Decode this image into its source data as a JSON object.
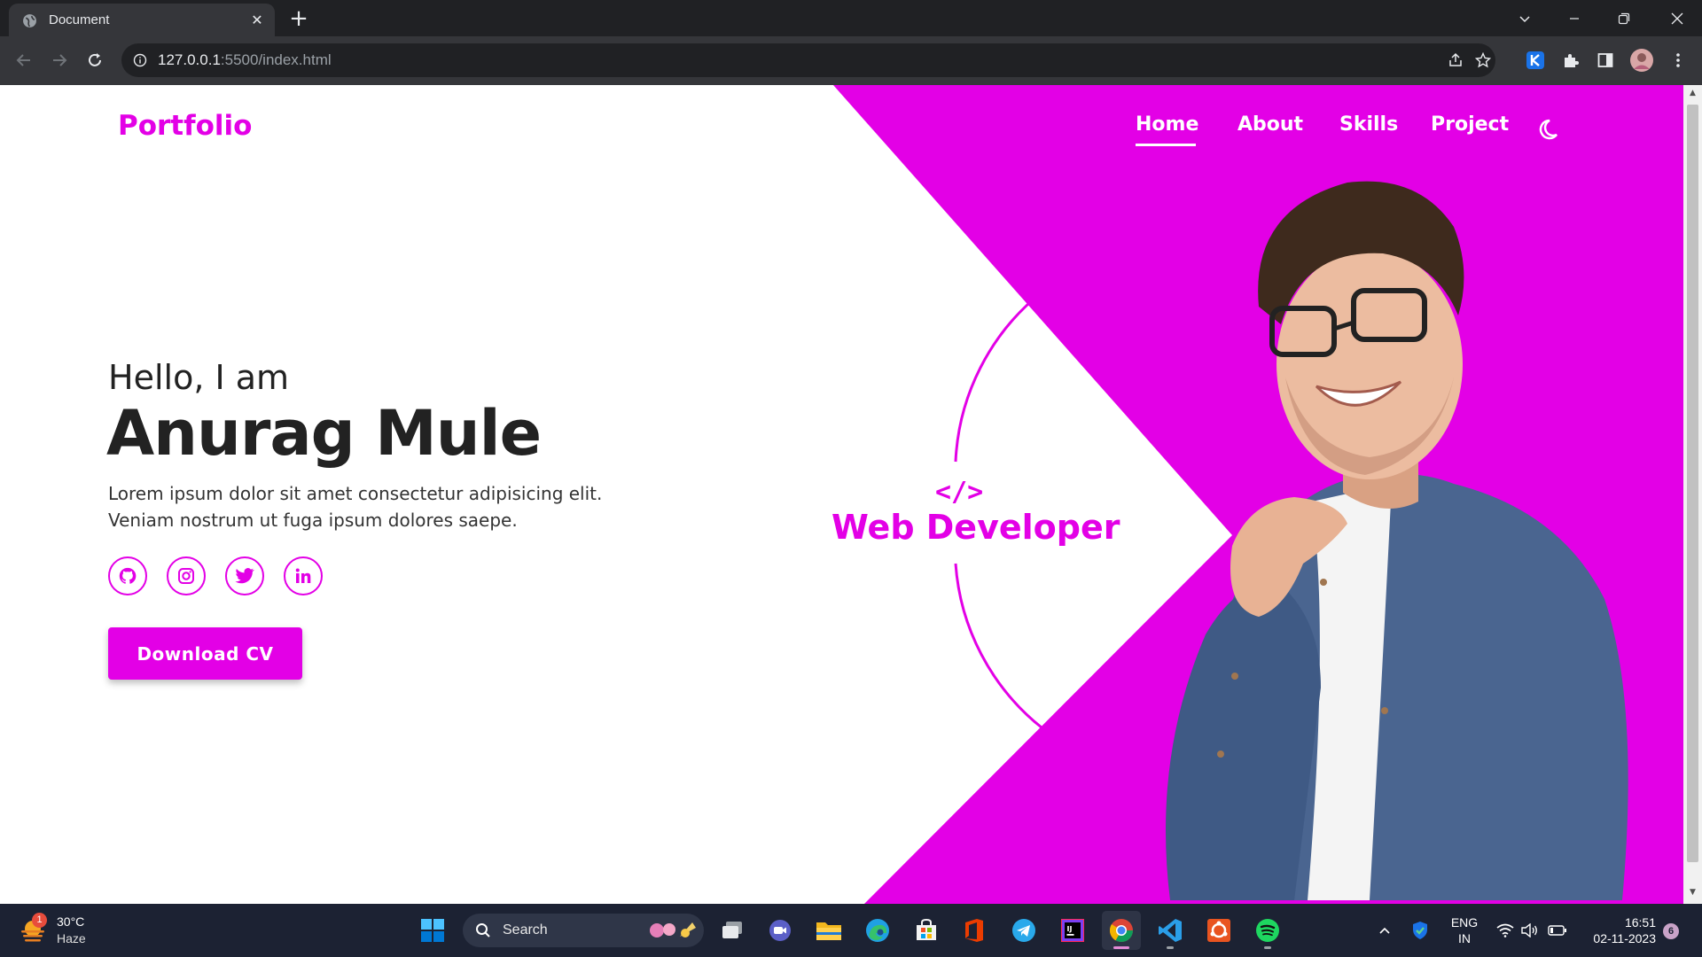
{
  "browser": {
    "tab_title": "Document",
    "url_host": "127.0.0.1",
    "url_rest": ":5500/index.html"
  },
  "site": {
    "logo": "Portfolio",
    "nav": [
      "Home",
      "About",
      "Skills",
      "Project"
    ],
    "hero": {
      "greeting": "Hello, I am",
      "name": "Anurag Mule",
      "description": "Lorem ipsum dolor sit amet consectetur adipisicing elit. Veniam nostrum ut fuga ipsum dolores saepe.",
      "cv_button": "Download CV",
      "code_symbol": "</>",
      "role": "Web Developer"
    },
    "social_icons": [
      "github-icon",
      "instagram-icon",
      "twitter-icon",
      "linkedin-icon"
    ],
    "accent_color": "#e300e6"
  },
  "taskbar": {
    "weather_temp": "30°C",
    "weather_cond": "Haze",
    "weather_badge": "1",
    "search_label": "Search",
    "lang_line1": "ENG",
    "lang_line2": "IN",
    "time": "16:51",
    "date": "02-11-2023",
    "notifications": "6"
  }
}
